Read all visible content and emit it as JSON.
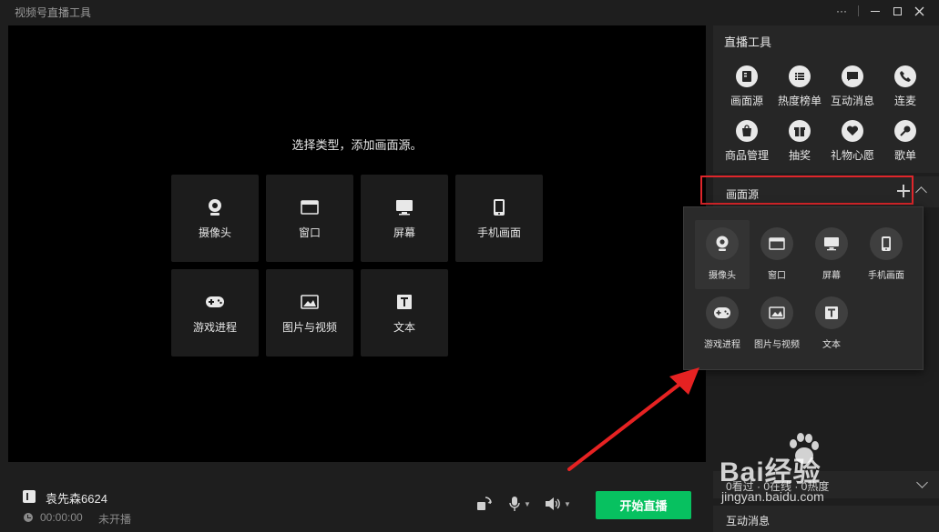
{
  "app": {
    "title": "视频号直播工具"
  },
  "window_controls": {
    "more": "···"
  },
  "stage": {
    "hint": "选择类型，添加画面源。",
    "sources": [
      {
        "label": "摄像头",
        "icon": "camera-icon"
      },
      {
        "label": "窗口",
        "icon": "window-icon"
      },
      {
        "label": "屏幕",
        "icon": "monitor-icon"
      },
      {
        "label": "手机画面",
        "icon": "phone-icon"
      },
      {
        "label": "游戏进程",
        "icon": "gamepad-icon"
      },
      {
        "label": "图片与视频",
        "icon": "image-icon"
      },
      {
        "label": "文本",
        "icon": "text-icon"
      }
    ]
  },
  "bottom": {
    "user_name": "袁先森6624",
    "timer": "00:00:00",
    "status": "未开播",
    "start_button": "开始直播"
  },
  "tools": {
    "header": "直播工具",
    "items": [
      {
        "label": "画面源",
        "icon": "source-icon"
      },
      {
        "label": "热度榜单",
        "icon": "list-icon"
      },
      {
        "label": "互动消息",
        "icon": "message-icon"
      },
      {
        "label": "连麦",
        "icon": "call-icon"
      },
      {
        "label": "商品管理",
        "icon": "bag-icon"
      },
      {
        "label": "抽奖",
        "icon": "gift-box-icon"
      },
      {
        "label": "礼物心愿",
        "icon": "heart-icon"
      },
      {
        "label": "歌单",
        "icon": "mic-icon"
      }
    ]
  },
  "source_panel": {
    "header": "画面源",
    "popup_items": [
      {
        "label": "摄像头",
        "icon": "camera-icon",
        "active": true
      },
      {
        "label": "窗口",
        "icon": "window-icon"
      },
      {
        "label": "屏幕",
        "icon": "monitor-icon"
      },
      {
        "label": "手机画面",
        "icon": "phone-icon"
      },
      {
        "label": "游戏进程",
        "icon": "gamepad-icon"
      },
      {
        "label": "图片与视频",
        "icon": "image-icon"
      },
      {
        "label": "文本",
        "icon": "text-icon"
      }
    ]
  },
  "stats": {
    "text": "0看过 · 0在线 · 0热度"
  },
  "messages": {
    "header": "互动消息"
  },
  "watermark": {
    "main": "Bai经验",
    "sub": "jingyan.baidu.com"
  },
  "colors": {
    "accent": "#07c160",
    "highlight": "#e0262b"
  }
}
